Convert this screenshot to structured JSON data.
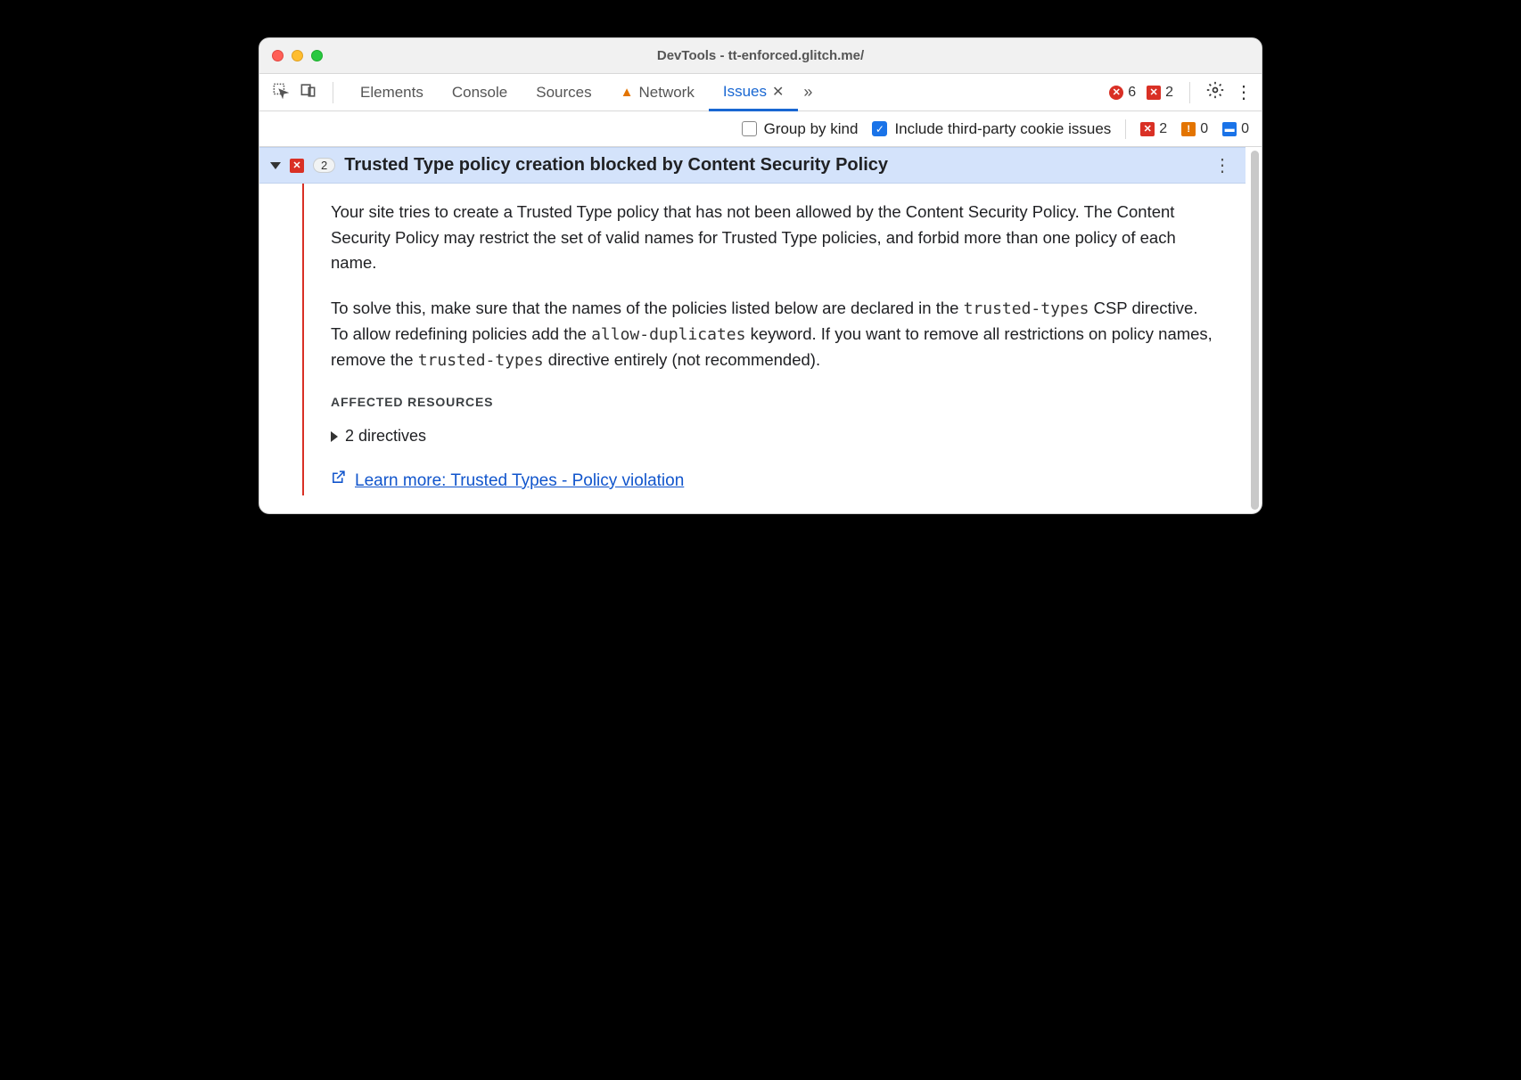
{
  "window": {
    "title": "DevTools - tt-enforced.glitch.me/"
  },
  "tabs": {
    "elements": "Elements",
    "console": "Console",
    "sources": "Sources",
    "network": "Network",
    "issues": "Issues"
  },
  "counts": {
    "errors_top": "6",
    "issues_top": "2",
    "toolbar_error": "2",
    "toolbar_warn": "0",
    "toolbar_info": "0"
  },
  "toolbar": {
    "group_by_kind": "Group by kind",
    "third_party": "Include third-party cookie issues"
  },
  "issue": {
    "count": "2",
    "title": "Trusted Type policy creation blocked by Content Security Policy",
    "para1": "Your site tries to create a Trusted Type policy that has not been allowed by the Content Security Policy. The Content Security Policy may restrict the set of valid names for Trusted Type policies, and forbid more than one policy of each name.",
    "para2a": "To solve this, make sure that the names of the policies listed below are declared in the ",
    "code1": "trusted-types",
    "para2b": " CSP directive. To allow redefining policies add the ",
    "code2": "allow-duplicates",
    "para2c": " keyword. If you want to remove all restrictions on policy names, remove the ",
    "code3": "trusted-types",
    "para2d": " directive entirely (not recommended).",
    "affected_label": "AFFECTED RESOURCES",
    "directives": "2 directives",
    "learn_more": "Learn more: Trusted Types - Policy violation"
  }
}
